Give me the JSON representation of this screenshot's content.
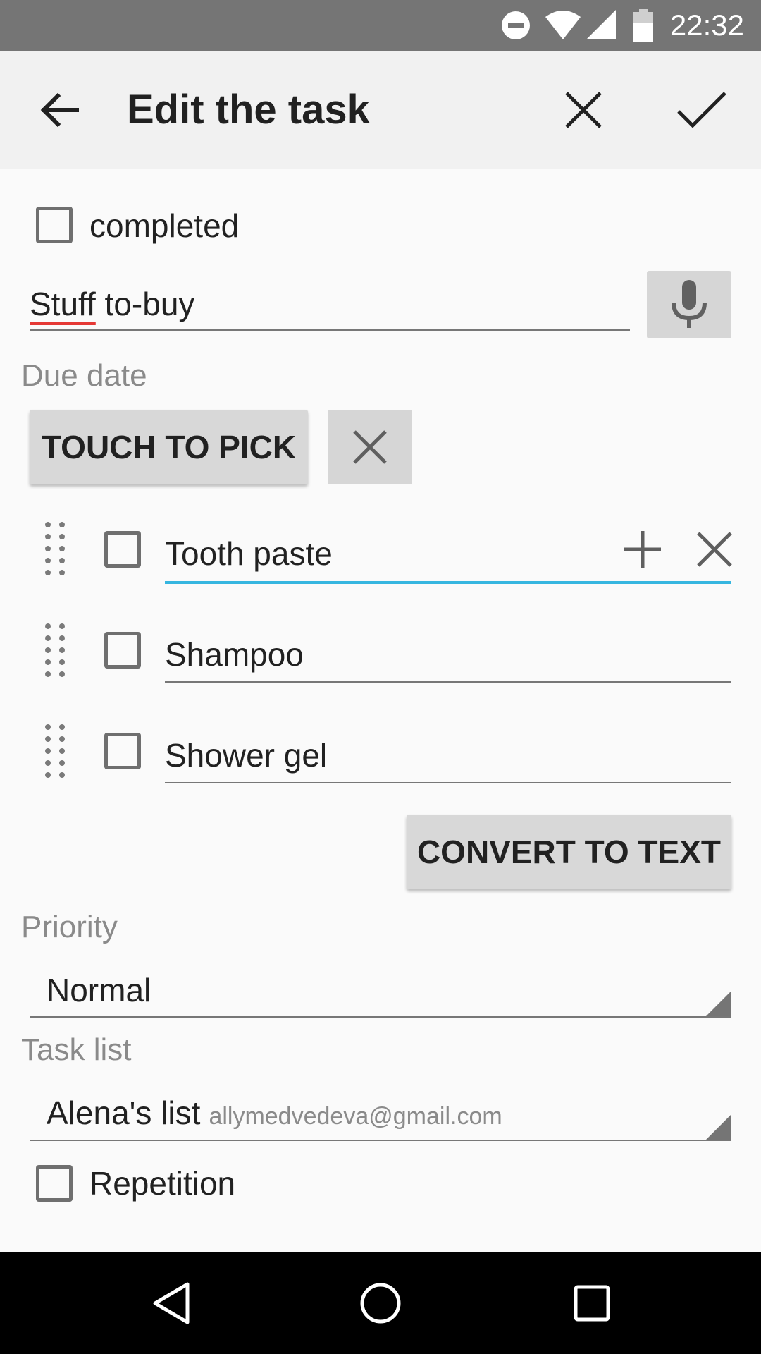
{
  "status_bar": {
    "time": "22:32"
  },
  "toolbar": {
    "title": "Edit the task"
  },
  "task": {
    "completed_label": "completed",
    "title_value": "Stuff",
    "title_rest": " to-buy"
  },
  "due_date": {
    "label": "Due date",
    "pick_button": "TOUCH TO PICK"
  },
  "checklist": {
    "items": [
      {
        "text": "Tooth paste"
      },
      {
        "text": "Shampoo"
      },
      {
        "text": "Shower gel"
      }
    ],
    "convert_button": "CONVERT TO TEXT"
  },
  "priority": {
    "label": "Priority",
    "value": "Normal"
  },
  "task_list": {
    "label": "Task list",
    "value": "Alena's list",
    "account": "allymedvedeva@gmail.com"
  },
  "repetition": {
    "label": "Repetition"
  },
  "colors": {
    "accent": "#36b6e0",
    "appbar": "#f1f1f1",
    "statusbar": "#757575"
  }
}
